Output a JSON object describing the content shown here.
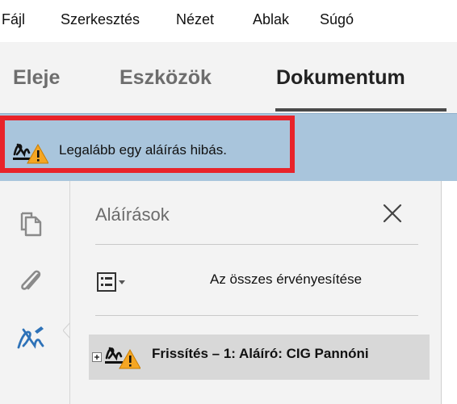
{
  "menubar": {
    "items": [
      {
        "label": "Fájl"
      },
      {
        "label": "Szerkesztés"
      },
      {
        "label": "Nézet"
      },
      {
        "label": "Ablak"
      },
      {
        "label": "Súgó"
      }
    ]
  },
  "toolbar": {
    "tabs": [
      {
        "label": "Eleje",
        "active": false
      },
      {
        "label": "Eszközök",
        "active": false
      },
      {
        "label": "Dokumentum",
        "active": true
      }
    ]
  },
  "notification": {
    "text": "Legalább egy aláírás hibás.",
    "icon": "signature-warning-icon",
    "background": "#a9c5dc",
    "highlight_color": "#e8232a"
  },
  "rail": {
    "icons": [
      "pages-icon",
      "attachment-icon",
      "signature-pen-icon"
    ]
  },
  "signatures_panel": {
    "title": "Aláírások",
    "options_icon": "list-options-icon",
    "validate_all_label": "Az összes érvényesítése",
    "signatures": [
      {
        "label": "Frissítés – 1: Aláíró: CIG Pannóni",
        "status_icon": "signature-warning-icon"
      }
    ]
  }
}
